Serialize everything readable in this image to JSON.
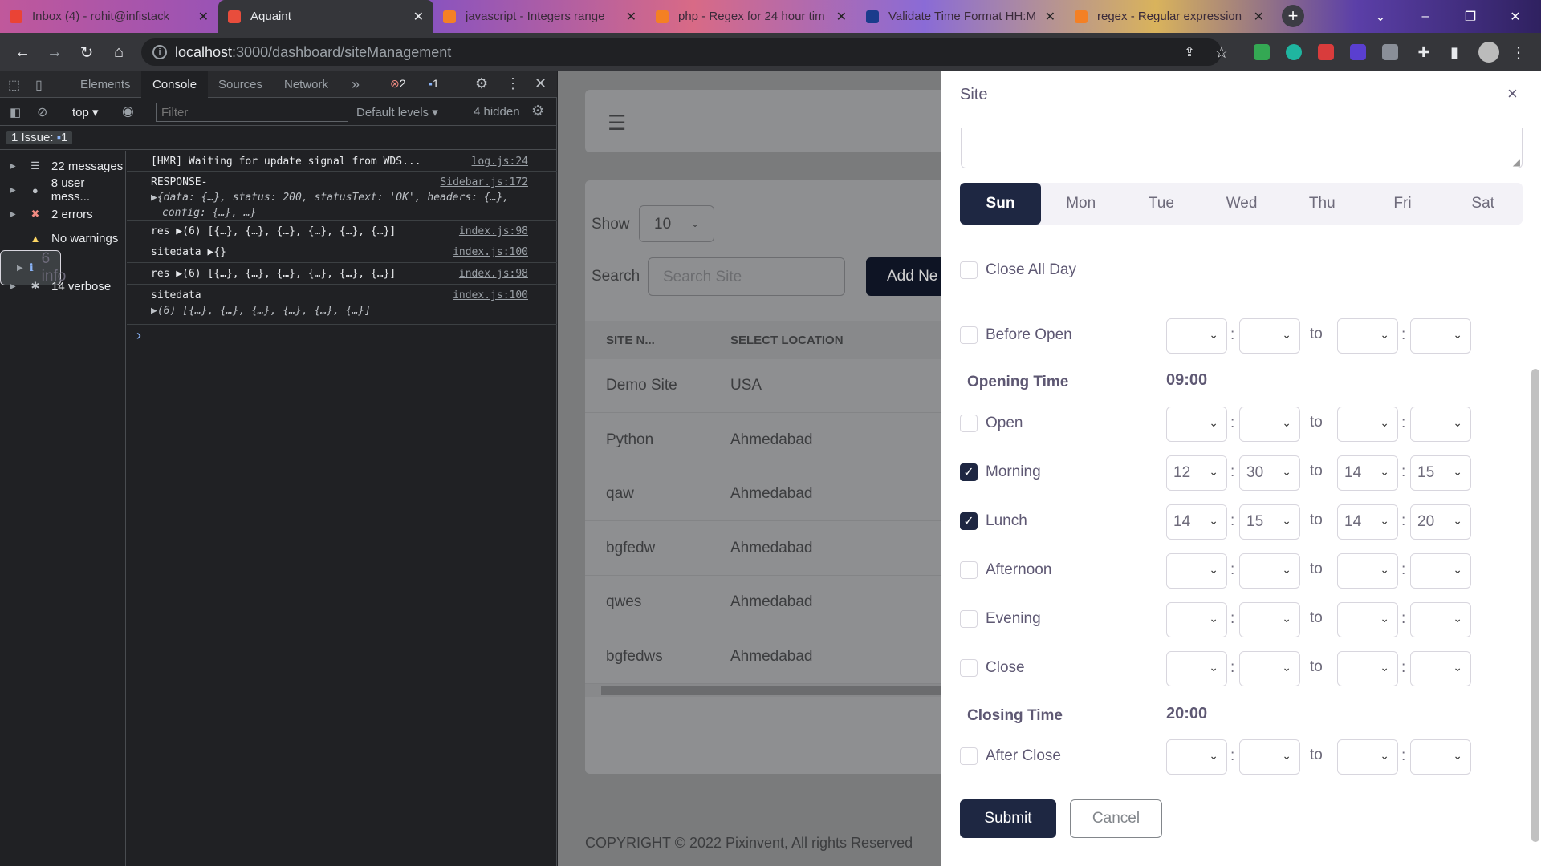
{
  "browser": {
    "tabs": [
      {
        "title": "Inbox (4) - rohit@infistack",
        "color": "#ea4335"
      },
      {
        "title": "Aquaint",
        "color": "#e84d3c"
      },
      {
        "title": "javascript - Integers range",
        "color": "#f48024"
      },
      {
        "title": "php - Regex for 24 hour tim",
        "color": "#f48024"
      },
      {
        "title": "Validate Time Format HH:M",
        "color": "#1a3c8c"
      },
      {
        "title": "regex - Regular expression",
        "color": "#f48024"
      }
    ],
    "url_host": "localhost",
    "url_path": ":3000/dashboard/siteManagement"
  },
  "devtools": {
    "tabs": [
      "Elements",
      "Console",
      "Sources",
      "Network"
    ],
    "more": "»",
    "error_count": "2",
    "message_count": "1",
    "context": "top",
    "filter_placeholder": "Filter",
    "levels": "Default levels",
    "hidden": "4 hidden",
    "issues_label": "1 Issue:",
    "issues_count": "1",
    "sidebar": [
      {
        "label": "22 messages",
        "icon": "list-icon"
      },
      {
        "label": "8 user mess...",
        "icon": "user-icon"
      },
      {
        "label": "2 errors",
        "icon": "error-icon"
      },
      {
        "label": "No warnings",
        "icon": "warning-icon"
      },
      {
        "label": "6 info",
        "icon": "info-icon"
      },
      {
        "label": "14 verbose",
        "icon": "bug-icon"
      }
    ],
    "logs": [
      {
        "text": "[HMR] Waiting for update signal from WDS...",
        "src": "log.js:24"
      },
      {
        "text": "RESPONSE-",
        "sub": "▶{data: {…}, status: 200, statusText: 'OK', headers: {…},",
        "sub2": "config: {…}, …}",
        "src": "Sidebar.js:172"
      },
      {
        "text": "res ▶(6) [{…}, {…}, {…}, {…}, {…}, {…}]",
        "src": "index.js:98"
      },
      {
        "text": "sitedata ▶{}",
        "src": "index.js:100"
      },
      {
        "text": "res ▶(6) [{…}, {…}, {…}, {…}, {…}, {…}]",
        "src": "index.js:98"
      },
      {
        "text": "sitedata",
        "sub": "▶(6) [{…}, {…}, {…}, {…}, {…}, {…}]",
        "src": "index.js:100"
      }
    ],
    "prompt": "›"
  },
  "app": {
    "show_label": "Show",
    "show_value": "10",
    "search_label": "Search",
    "search_placeholder": "Search Site",
    "add_button": "Add Ne",
    "columns": [
      "SITE N...",
      "SELECT LOCATION"
    ],
    "rows": [
      [
        "Demo Site",
        "USA"
      ],
      [
        "Python",
        "Ahmedabad"
      ],
      [
        "qaw",
        "Ahmedabad"
      ],
      [
        "bgfedw",
        "Ahmedabad"
      ],
      [
        "qwes",
        "Ahmedabad"
      ],
      [
        "bgfedws",
        "Ahmedabad"
      ]
    ],
    "footer": "COPYRIGHT © 2022 Pixinvent, All rights Reserved"
  },
  "panel": {
    "title": "Site",
    "close": "×",
    "days": [
      "Sun",
      "Mon",
      "Tue",
      "Wed",
      "Thu",
      "Fri",
      "Sat"
    ],
    "active_day": "Sun",
    "close_all_day": "Close All Day",
    "opening_time_label": "Opening Time",
    "opening_time": "09:00",
    "closing_time_label": "Closing Time",
    "closing_time": "20:00",
    "to": "to",
    "slots": [
      {
        "label": "Before Open",
        "checked": false,
        "values": [
          "",
          "",
          "",
          ""
        ]
      },
      {
        "label": "Open",
        "checked": false,
        "values": [
          "",
          "",
          "",
          ""
        ]
      },
      {
        "label": "Morning",
        "checked": true,
        "values": [
          "12",
          "30",
          "14",
          "15"
        ]
      },
      {
        "label": "Lunch",
        "checked": true,
        "values": [
          "14",
          "15",
          "14",
          "20"
        ]
      },
      {
        "label": "Afternoon",
        "checked": false,
        "values": [
          "",
          "",
          "",
          ""
        ]
      },
      {
        "label": "Evening",
        "checked": false,
        "values": [
          "",
          "",
          "",
          ""
        ]
      },
      {
        "label": "Close",
        "checked": false,
        "values": [
          "",
          "",
          "",
          ""
        ]
      },
      {
        "label": "After Close",
        "checked": false,
        "values": [
          "",
          "",
          "",
          ""
        ]
      }
    ],
    "submit": "Submit",
    "cancel": "Cancel"
  }
}
